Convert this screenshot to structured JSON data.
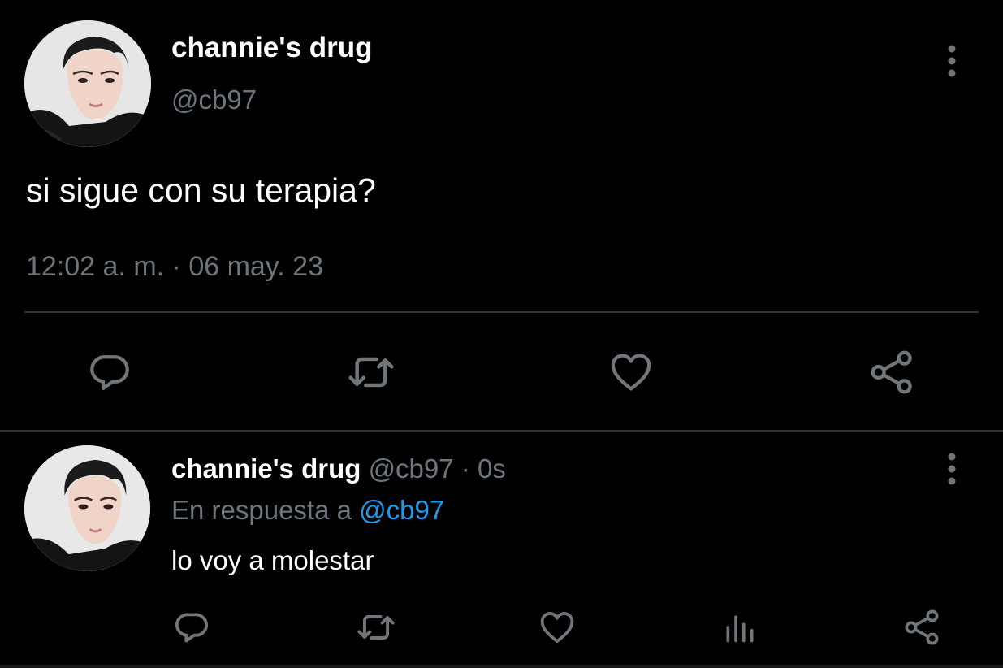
{
  "main_tweet": {
    "display_name": "channie's drug",
    "handle": "@cb97",
    "text": "si sigue con su terapia?",
    "timestamp": "12:02 a. m. · 06 may. 23",
    "more_icon": "more-vertical-icon",
    "actions": [
      {
        "name": "reply",
        "icon": "reply-icon"
      },
      {
        "name": "retweet",
        "icon": "retweet-icon"
      },
      {
        "name": "like",
        "icon": "heart-icon"
      },
      {
        "name": "share",
        "icon": "share-icon"
      }
    ]
  },
  "reply_tweet": {
    "display_name": "channie's drug",
    "meta": "@cb97 · 0s",
    "reply_prefix": "En respuesta a",
    "reply_mention": "@cb97",
    "text": "lo voy a molestar",
    "more_icon": "more-vertical-icon",
    "actions": [
      {
        "name": "reply",
        "icon": "reply-icon"
      },
      {
        "name": "retweet",
        "icon": "retweet-icon"
      },
      {
        "name": "like",
        "icon": "heart-icon"
      },
      {
        "name": "analytics",
        "icon": "analytics-icon"
      },
      {
        "name": "share",
        "icon": "share-icon"
      }
    ]
  },
  "colors": {
    "background": "#000000",
    "primary_text": "#ffffff",
    "secondary_text": "#6e767d",
    "icon": "#71767b",
    "divider": "#2f3336",
    "link": "#1d9bf0"
  }
}
